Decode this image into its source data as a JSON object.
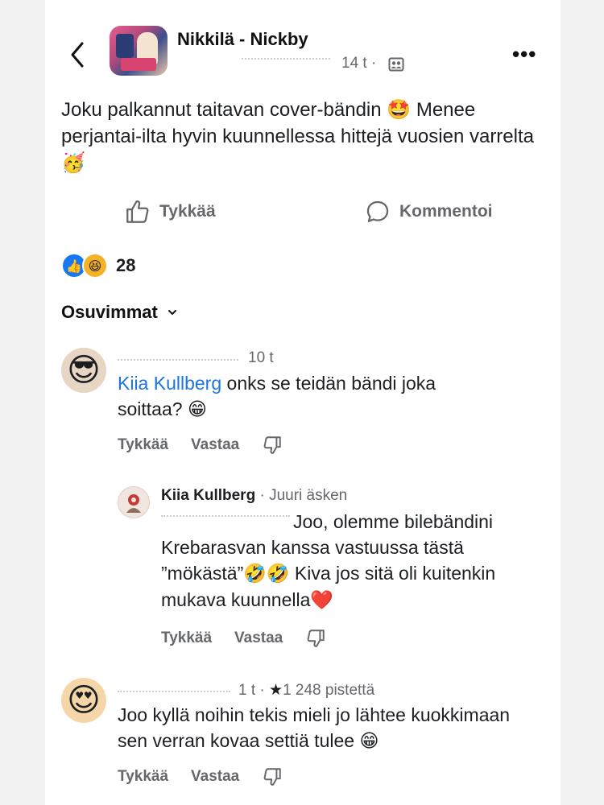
{
  "header": {
    "group_name": "Nikkilä - Nickby",
    "post_time": "14 t ·",
    "back_icon": "chevron-left-icon",
    "privacy_icon": "group-icon",
    "more_label": "•••"
  },
  "post": {
    "text_1": "Joku palkannut taitavan cover-bändin ",
    "emoji_1": "🤩",
    "text_2": " Menee perjantai-ilta hyvin kuunnellessa hittejä vuosien varrelta ",
    "emoji_2": "🥳"
  },
  "actions": {
    "like_label": "Tykkää",
    "comment_label": "Kommentoi"
  },
  "reactions": {
    "like_glyph": "👍",
    "haha_glyph": "😆",
    "count": "28"
  },
  "sort": {
    "label": "Osuvimmat"
  },
  "comments": [
    {
      "avatar": "😎",
      "time": "10 t",
      "mention": "Kiia Kullberg",
      "text": " onks se teidän bändi joka soittaa? ",
      "emoji": "😁",
      "like": "Tykkää",
      "reply": "Vastaa"
    },
    {
      "author": "Kiia Kullberg",
      "meta": " · Juuri äsken",
      "text": "Joo, olemme bilebändini Krebarasvan kanssa vastuussa tästä ”mökästä”",
      "emoji_a": "🤣🤣",
      "text_b": " Kiva jos sitä oli kuitenkin mukava kuunnella",
      "emoji_b": "❤️",
      "like": "Tykkää",
      "reply": "Vastaa"
    },
    {
      "avatar": "😍",
      "time": "1 t · ",
      "star": "★",
      "points": "1 248 pistettä",
      "text": "Joo kyllä noihin tekis mieli jo lähtee kuokkimaan sen verran kovaa settiä tulee ",
      "emoji": "😁",
      "like": "Tykkää",
      "reply": "Vastaa"
    }
  ]
}
